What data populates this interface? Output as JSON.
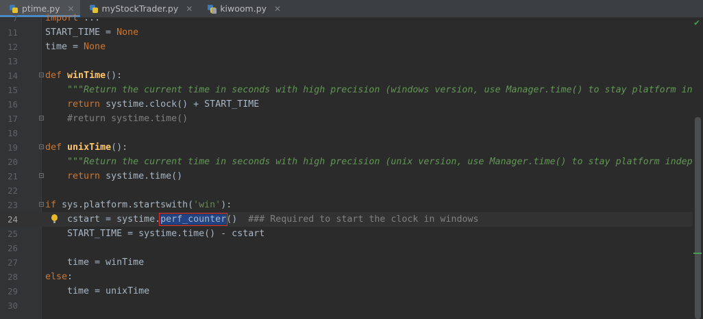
{
  "tabs": [
    {
      "label": "ptime.py",
      "active": true,
      "close": "✕"
    },
    {
      "label": "myStockTrader.py",
      "active": false,
      "close": "✕"
    },
    {
      "label": "kiwoom.py",
      "active": false,
      "close": "✕"
    }
  ],
  "editor": {
    "lines": [
      {
        "n": "7",
        "code": "import ..."
      },
      {
        "n": "11",
        "code": "START_TIME = None"
      },
      {
        "n": "12",
        "code": "time = None"
      },
      {
        "n": "13",
        "code": ""
      },
      {
        "n": "14",
        "code": "def winTime():"
      },
      {
        "n": "15",
        "code": "    \"\"\"Return the current time in seconds with high precision (windows version, use Manager.time() to stay platform inde"
      },
      {
        "n": "16",
        "code": "    return systime.clock() + START_TIME"
      },
      {
        "n": "17",
        "code": "    #return systime.time()"
      },
      {
        "n": "18",
        "code": ""
      },
      {
        "n": "19",
        "code": "def unixTime():"
      },
      {
        "n": "20",
        "code": "    \"\"\"Return the current time in seconds with high precision (unix version, use Manager.time() to stay platform indepen"
      },
      {
        "n": "21",
        "code": "    return systime.time()"
      },
      {
        "n": "22",
        "code": ""
      },
      {
        "n": "23",
        "code": "if sys.platform.startswith('win'):"
      },
      {
        "n": "24",
        "code": "    cstart = systime.perf_counter()  ### Required to start the clock in windows"
      },
      {
        "n": "25",
        "code": "    START_TIME = systime.time() - cstart"
      },
      {
        "n": "26",
        "code": ""
      },
      {
        "n": "27",
        "code": "    time = winTime"
      },
      {
        "n": "28",
        "code": "else:"
      },
      {
        "n": "29",
        "code": "    time = unixTime"
      },
      {
        "n": "30",
        "code": ""
      }
    ],
    "current_line": "24",
    "selected_text": "perf_counter"
  },
  "status": {
    "inspection": "✔"
  },
  "colors": {
    "keyword": "#cc7832",
    "function": "#ffc66d",
    "string": "#6a8759",
    "docstring": "#629755",
    "comment": "#808080",
    "selection": "#214283",
    "highlight_box": "#e83232"
  }
}
